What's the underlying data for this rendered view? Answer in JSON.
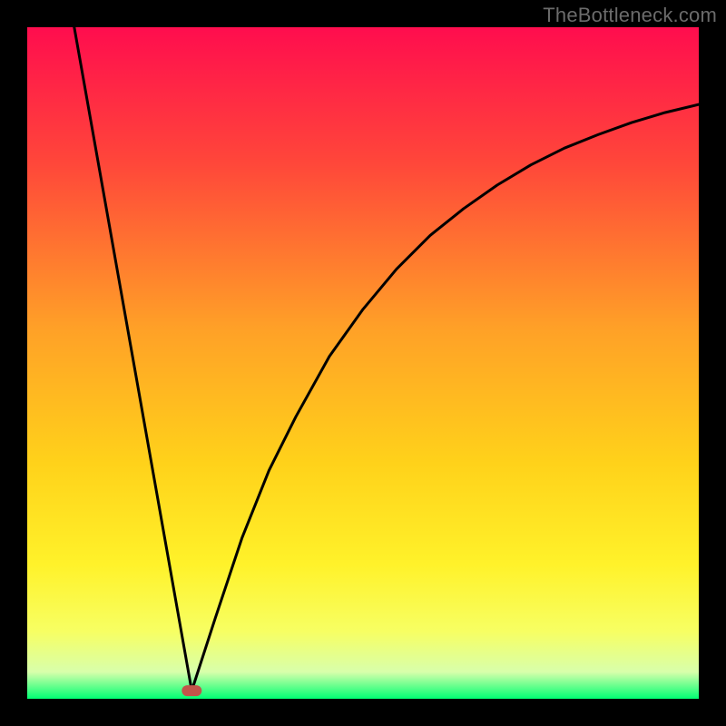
{
  "watermark": "TheBottleneck.com",
  "chart_data": {
    "type": "line",
    "title": "",
    "xlabel": "",
    "ylabel": "",
    "xlim": [
      0,
      100
    ],
    "ylim": [
      0,
      100
    ],
    "gradient_stops": [
      {
        "offset": 0,
        "color": "#ff0d4e"
      },
      {
        "offset": 20,
        "color": "#ff463a"
      },
      {
        "offset": 45,
        "color": "#ffa127"
      },
      {
        "offset": 65,
        "color": "#ffd21a"
      },
      {
        "offset": 80,
        "color": "#fff22a"
      },
      {
        "offset": 90,
        "color": "#f7ff63"
      },
      {
        "offset": 96,
        "color": "#d8ffab"
      },
      {
        "offset": 100,
        "color": "#00ff73"
      }
    ],
    "marker": {
      "x": 24.5,
      "y": 1.2,
      "color": "#c1554a"
    },
    "series": [
      {
        "name": "left-branch",
        "x": [
          7,
          24.5
        ],
        "y": [
          100,
          1.2
        ]
      },
      {
        "name": "right-branch",
        "x": [
          24.5,
          28,
          32,
          36,
          40,
          45,
          50,
          55,
          60,
          65,
          70,
          75,
          80,
          85,
          90,
          95,
          100
        ],
        "y": [
          1.2,
          12,
          24,
          34,
          42,
          51,
          58,
          64,
          69,
          73,
          76.5,
          79.5,
          82,
          84,
          85.8,
          87.3,
          88.5
        ]
      }
    ]
  }
}
